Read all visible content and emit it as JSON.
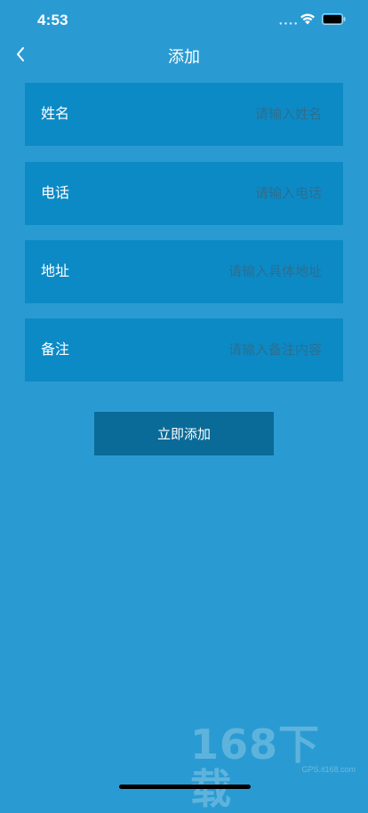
{
  "status_bar": {
    "time": "4:53"
  },
  "nav": {
    "title": "添加",
    "back_icon": "chevron-left-icon"
  },
  "form": {
    "fields": [
      {
        "label": "姓名",
        "value": "",
        "placeholder": "请输入姓名"
      },
      {
        "label": "电话",
        "value": "",
        "placeholder": "请输入电话"
      },
      {
        "label": "地址",
        "value": "",
        "placeholder": "请输入具体地址"
      },
      {
        "label": "备注",
        "value": "",
        "placeholder": "请输入备注内容"
      }
    ]
  },
  "submit": {
    "label": "立即添加"
  },
  "watermark": {
    "text": "168下载",
    "sub": "GPS.it168.com"
  },
  "colors": {
    "background": "#2a9bd2",
    "row_background": "#0c8ac6",
    "button_background": "#0a6b98",
    "placeholder": "#2b6f8f"
  }
}
